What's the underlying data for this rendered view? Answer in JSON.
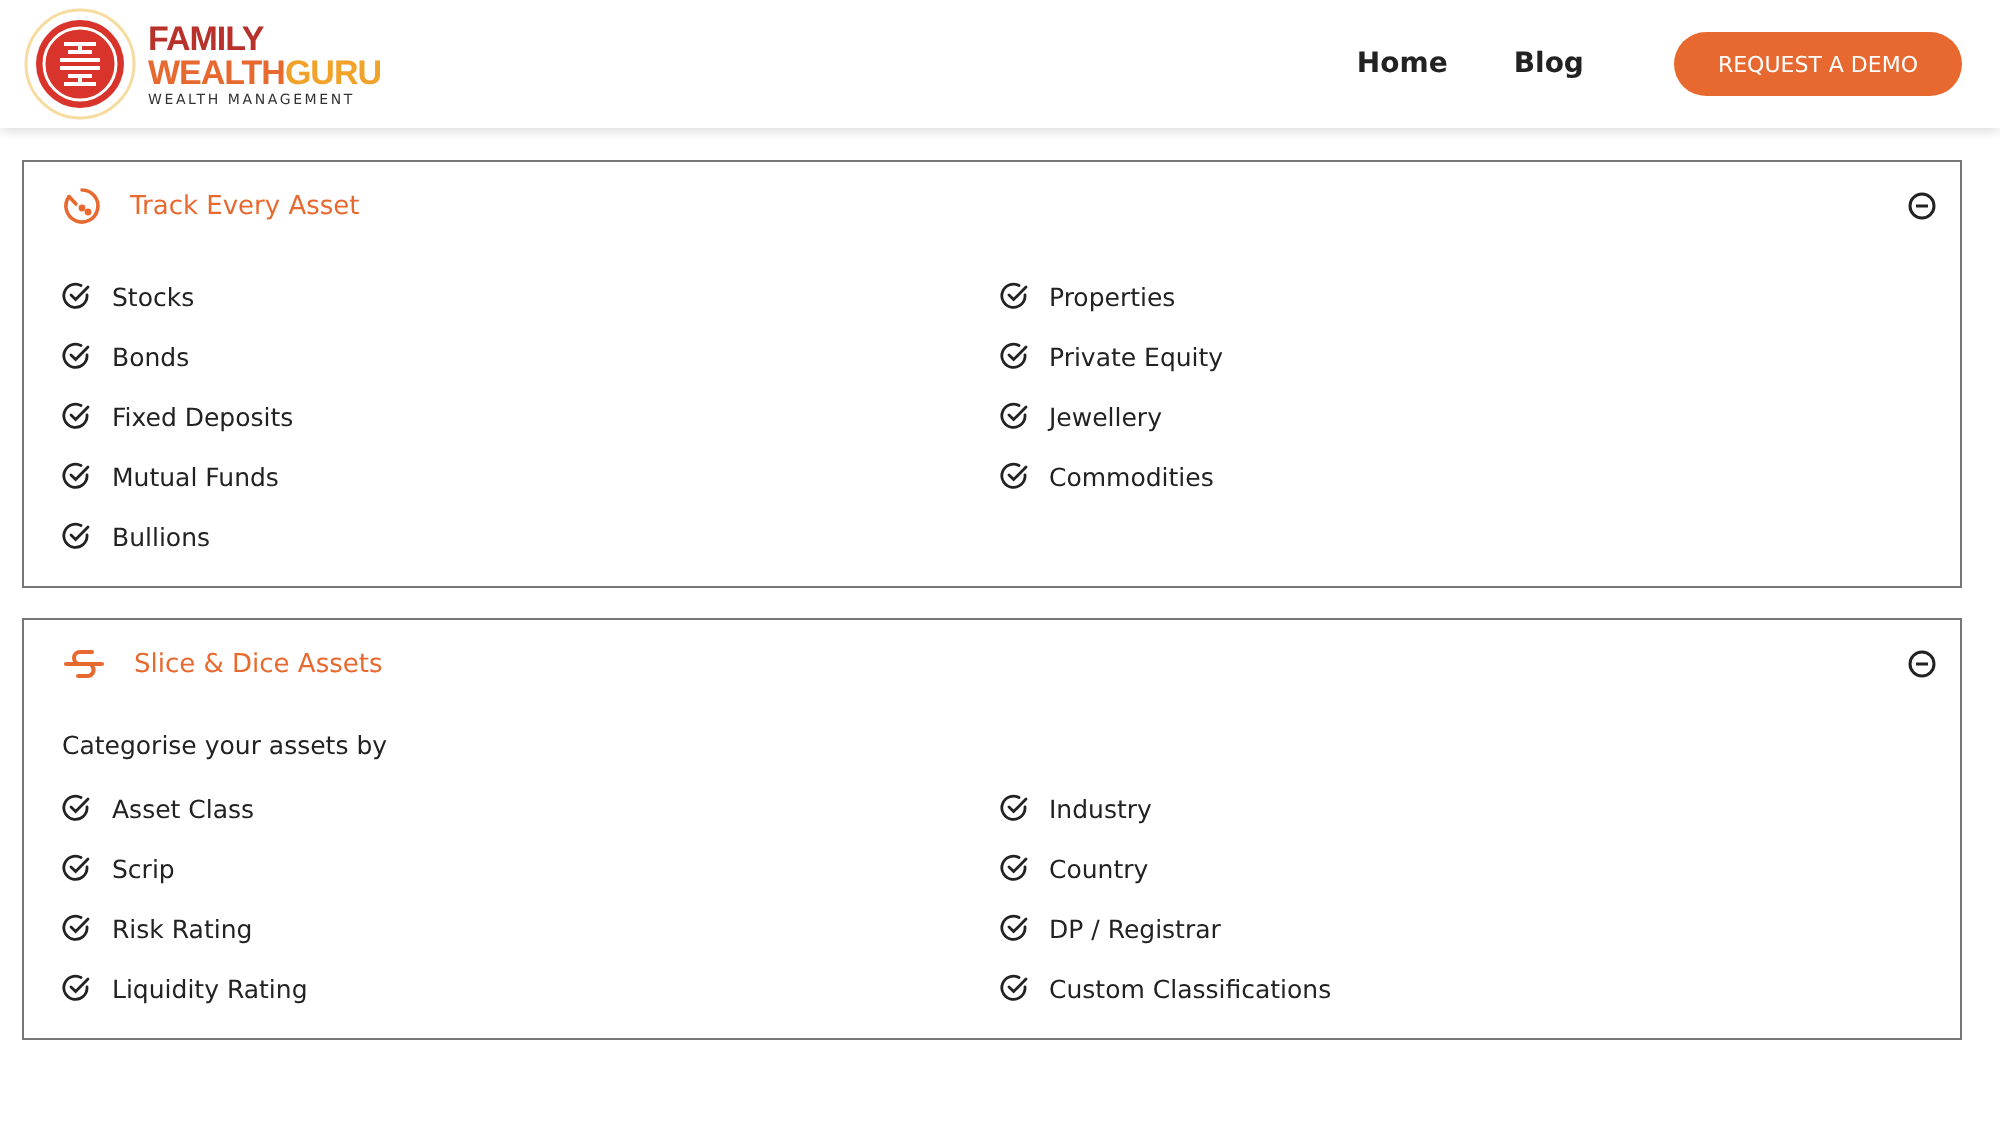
{
  "logo": {
    "name_top": "FAMILY",
    "name_main": "WEALTH",
    "name_accent": "GURU",
    "tagline": "WEALTH MANAGEMENT"
  },
  "nav": [
    {
      "label": "Home"
    },
    {
      "label": "Blog"
    }
  ],
  "cta": {
    "label": "REQUEST A DEMO"
  },
  "sections": [
    {
      "title": "Track Every Asset",
      "expanded": true,
      "columns": [
        [
          "Stocks",
          "Bonds",
          "Fixed Deposits",
          "Mutual Funds",
          "Bullions"
        ],
        [
          "Properties",
          "Private Equity",
          "Jewellery",
          "Commodities"
        ]
      ]
    },
    {
      "title": "Slice & Dice Assets",
      "expanded": true,
      "intro": "Categorise your assets by",
      "columns": [
        [
          "Asset Class",
          "Scrip",
          "Risk Rating",
          "Liquidity Rating"
        ],
        [
          "Industry",
          "Country",
          "DP / Registrar",
          "Custom Classifications"
        ]
      ]
    }
  ]
}
